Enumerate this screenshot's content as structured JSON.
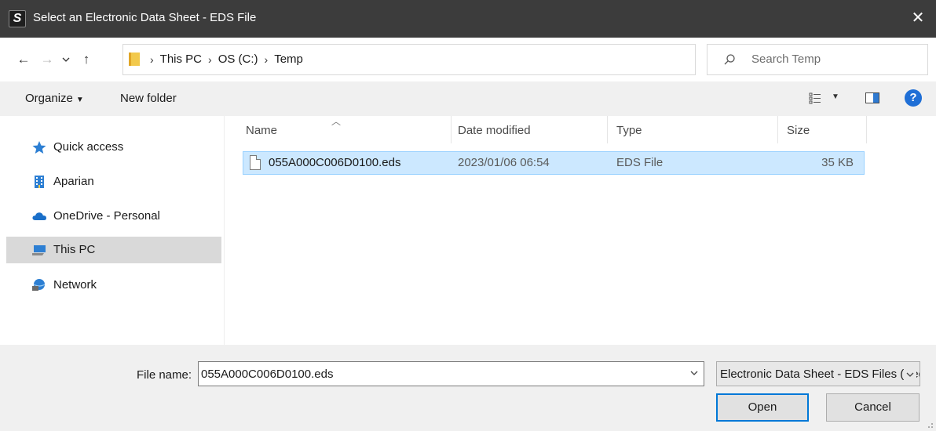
{
  "window": {
    "app_icon_glyph": "S",
    "title": "Select an Electronic Data Sheet - EDS File",
    "close_glyph": "✕"
  },
  "nav": {
    "back_glyph": "←",
    "forward_glyph": "→",
    "recent_glyph": "⌄",
    "up_glyph": "↑",
    "breadcrumbs": [
      "This PC",
      "OS (C:)",
      "Temp"
    ],
    "refresh_glyph": "↻",
    "search_placeholder": "Search Temp"
  },
  "toolbar": {
    "organize_label": "Organize",
    "new_folder_label": "New folder",
    "help_glyph": "?"
  },
  "sidebar": {
    "items": [
      {
        "label": "Quick access",
        "icon": "star-icon"
      },
      {
        "label": "Aparian",
        "icon": "building-icon"
      },
      {
        "label": "OneDrive - Personal",
        "icon": "cloud-icon"
      },
      {
        "label": "This PC",
        "icon": "computer-icon",
        "selected": true
      },
      {
        "label": "Network",
        "icon": "network-icon"
      }
    ]
  },
  "filelist": {
    "columns": [
      "Name",
      "Date modified",
      "Type",
      "Size"
    ],
    "rows": [
      {
        "name": "055A000C006D0100.eds",
        "date": "2023/01/06 06:54",
        "type": "EDS File",
        "size": "35 KB",
        "selected": true
      }
    ]
  },
  "footer": {
    "filename_label": "File name:",
    "filename_value": "055A000C006D0100.eds",
    "filter_value": "Electronic Data Sheet - EDS Files (*.eds)",
    "open_label": "Open",
    "cancel_label": "Cancel"
  },
  "colors": {
    "titlebar": "#3c3c3c",
    "selection": "#cce8ff",
    "accent": "#0078d7"
  }
}
